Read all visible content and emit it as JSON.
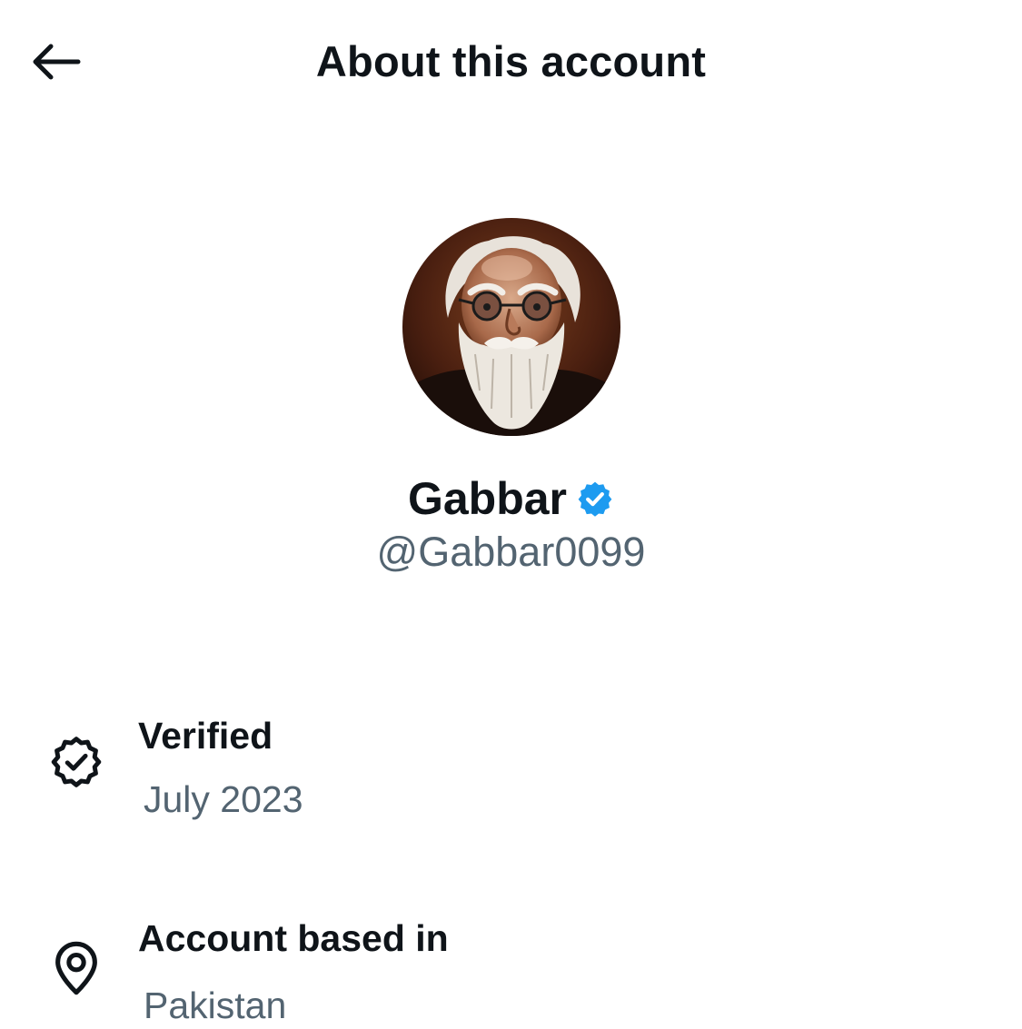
{
  "header": {
    "title": "About this account",
    "back_icon": "arrow-left-icon"
  },
  "profile": {
    "display_name": "Gabbar",
    "handle": "@Gabbar0099",
    "verified_badge_icon": "verified-badge-icon",
    "verified_badge_color": "#1d9bf0",
    "avatar": "avatar-portrait"
  },
  "details": [
    {
      "icon": "verified-seal-icon",
      "label": "Verified",
      "value": "July 2023"
    },
    {
      "icon": "location-pin-icon",
      "label": "Account based in",
      "value": "Pakistan"
    }
  ],
  "colors": {
    "text_primary": "#0f1419",
    "text_secondary": "#536471",
    "accent": "#1d9bf0"
  }
}
